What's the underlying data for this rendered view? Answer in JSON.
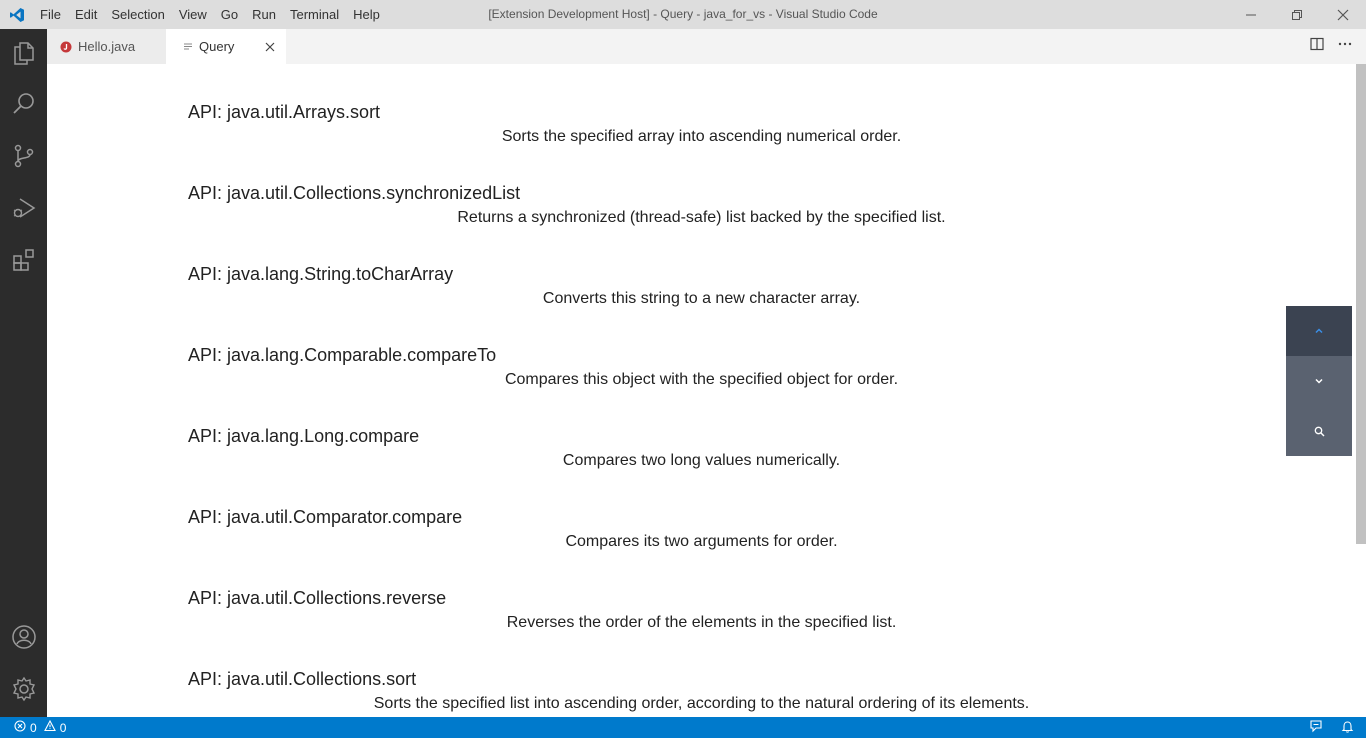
{
  "window": {
    "title": "[Extension Development Host] - Query - java_for_vs - Visual Studio Code",
    "menu": [
      "File",
      "Edit",
      "Selection",
      "View",
      "Go",
      "Run",
      "Terminal",
      "Help"
    ]
  },
  "tabs": [
    {
      "label": "Hello.java",
      "icon": "java-file-icon",
      "active": false
    },
    {
      "label": "Query",
      "icon": "preview-icon",
      "active": true
    }
  ],
  "activity_bar": [
    "explorer-icon",
    "search-icon",
    "source-control-icon",
    "run-debug-icon",
    "extensions-icon",
    "accounts-icon",
    "manage-gear-icon"
  ],
  "results": [
    {
      "api": "API: java.util.Arrays.sort",
      "desc": "Sorts the specified array into ascending numerical order."
    },
    {
      "api": "API: java.util.Collections.synchronizedList",
      "desc": "Returns a synchronized (thread-safe) list backed by the specified list."
    },
    {
      "api": "API: java.lang.String.toCharArray",
      "desc": "Converts this string to a new character array."
    },
    {
      "api": "API: java.lang.Comparable.compareTo",
      "desc": "Compares this object with the specified object for order."
    },
    {
      "api": "API: java.lang.Long.compare",
      "desc": "Compares two long values numerically."
    },
    {
      "api": "API: java.util.Comparator.compare",
      "desc": "Compares its two arguments for order."
    },
    {
      "api": "API: java.util.Collections.reverse",
      "desc": "Reverses the order of the elements in the specified list."
    },
    {
      "api": "API: java.util.Collections.sort",
      "desc": "Sorts the specified list into ascending order, according to the natural ordering of its elements."
    }
  ],
  "status": {
    "errors": "0",
    "warnings": "0"
  },
  "colors": {
    "status_bar": "#007acc",
    "activity_bar": "#2c2c2c",
    "title_bar": "#dddddd",
    "nav_up_active": "#3b4351",
    "nav_buttons": "#5a6270"
  }
}
